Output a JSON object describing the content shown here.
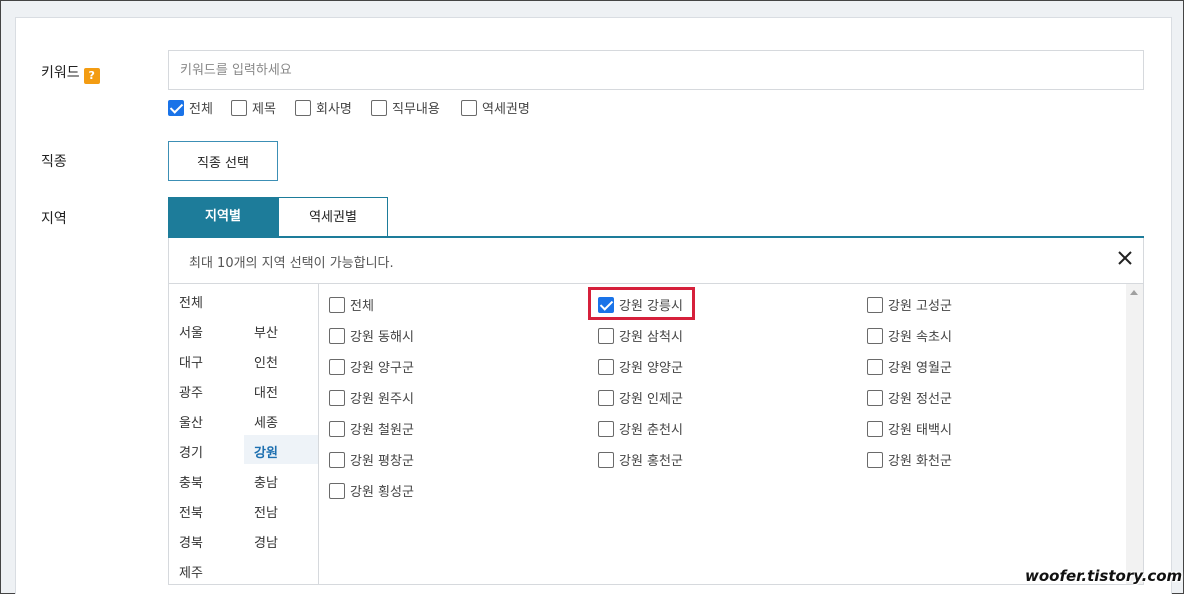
{
  "keyword": {
    "label": "키워드",
    "help_icon": "?",
    "placeholder": "키워드를 입력하세요",
    "options": [
      {
        "label": "전체",
        "checked": true
      },
      {
        "label": "제목",
        "checked": false
      },
      {
        "label": "회사명",
        "checked": false
      },
      {
        "label": "직무내용",
        "checked": false
      },
      {
        "label": "역세권명",
        "checked": false
      }
    ]
  },
  "job": {
    "label": "직종",
    "button": "직종 선택"
  },
  "region": {
    "label": "지역",
    "tabs": [
      {
        "label": "지역별",
        "active": true
      },
      {
        "label": "역세권별",
        "active": false
      }
    ],
    "notice": "최대 10개의 지역 선택이 가능합니다.",
    "provinces": [
      "전체",
      "서울",
      "부산",
      "대구",
      "인천",
      "광주",
      "대전",
      "울산",
      "세종",
      "경기",
      "강원",
      "충북",
      "충남",
      "전북",
      "전남",
      "경북",
      "경남",
      "제주"
    ],
    "selected_province": "강원",
    "cities": [
      {
        "label": "전체",
        "checked": false
      },
      {
        "label": "강원 강릉시",
        "checked": true
      },
      {
        "label": "강원 고성군",
        "checked": false
      },
      {
        "label": "강원 동해시",
        "checked": false
      },
      {
        "label": "강원 삼척시",
        "checked": false
      },
      {
        "label": "강원 속초시",
        "checked": false
      },
      {
        "label": "강원 양구군",
        "checked": false
      },
      {
        "label": "강원 양양군",
        "checked": false
      },
      {
        "label": "강원 영월군",
        "checked": false
      },
      {
        "label": "강원 원주시",
        "checked": false
      },
      {
        "label": "강원 인제군",
        "checked": false
      },
      {
        "label": "강원 정선군",
        "checked": false
      },
      {
        "label": "강원 철원군",
        "checked": false
      },
      {
        "label": "강원 춘천시",
        "checked": false
      },
      {
        "label": "강원 태백시",
        "checked": false
      },
      {
        "label": "강원 평창군",
        "checked": false
      },
      {
        "label": "강원 홍천군",
        "checked": false
      },
      {
        "label": "강원 화천군",
        "checked": false
      },
      {
        "label": "강원 횡성군",
        "checked": false
      }
    ]
  },
  "watermark": "woofer.tistory.com",
  "colors": {
    "accent": "#1d7c9a",
    "checkbox": "#1a73e8",
    "highlight": "#d6203b",
    "help": "#f39c12"
  }
}
